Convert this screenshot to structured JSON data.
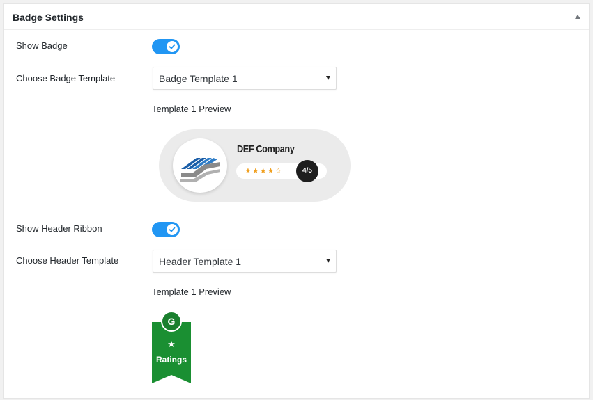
{
  "panel": {
    "title": "Badge Settings"
  },
  "show_badge": {
    "label": "Show Badge",
    "enabled": true
  },
  "badge_template": {
    "label": "Choose Badge Template",
    "selected": "Badge Template 1",
    "preview_label": "Template 1 Preview"
  },
  "badge_preview": {
    "company": "DEF Company",
    "stars": "★★★★☆",
    "score": "4/5"
  },
  "show_header_ribbon": {
    "label": "Show Header Ribbon",
    "enabled": true
  },
  "header_template": {
    "label": "Choose Header Template",
    "selected": "Header Template 1",
    "preview_label": "Template 1 Preview"
  },
  "ribbon_preview": {
    "icon_letter": "G",
    "star": "★",
    "text": "Ratings"
  },
  "colors": {
    "toggle_on": "#2196f3",
    "ribbon_green": "#1a8f32",
    "star_orange": "#f0a020"
  }
}
